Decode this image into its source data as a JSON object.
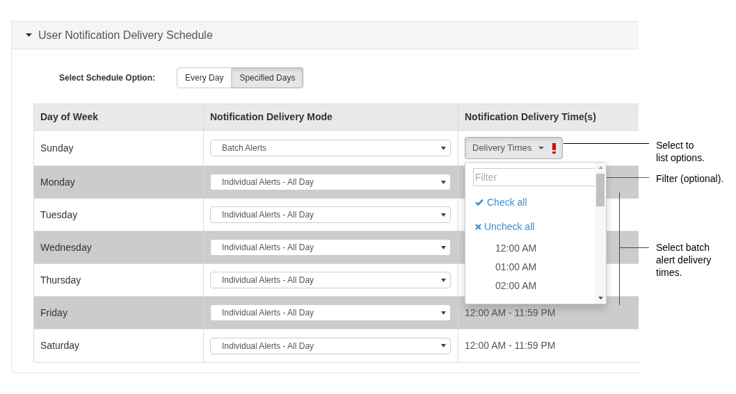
{
  "panel": {
    "title": "User Notification Delivery Schedule",
    "expanded": true
  },
  "schedule_option": {
    "label": "Select Schedule Option:",
    "options": [
      {
        "label": "Every Day",
        "selected": false
      },
      {
        "label": "Specified Days",
        "selected": true
      }
    ]
  },
  "table": {
    "columns": [
      "Day of Week",
      "Notification Delivery Mode",
      "Notification Delivery Time(s)"
    ],
    "rows": [
      {
        "day": "Sunday",
        "mode": "Batch Alerts",
        "time": {
          "kind": "picker",
          "label": "Delivery Times",
          "invalid": true,
          "open": true,
          "menu": {
            "filter_placeholder": "Filter",
            "actions": [
              {
                "kind": "check",
                "label": "Check all"
              },
              {
                "kind": "uncheck",
                "label": "Uncheck all"
              }
            ],
            "options": [
              "12:00 AM",
              "01:00 AM",
              "02:00 AM"
            ]
          }
        }
      },
      {
        "day": "Monday",
        "mode": "Individual Alerts - All Day"
      },
      {
        "day": "Tuesday",
        "mode": "Individual Alerts - All Day"
      },
      {
        "day": "Wednesday",
        "mode": "Individual Alerts - All Day"
      },
      {
        "day": "Thursday",
        "mode": "Individual Alerts - All Day"
      },
      {
        "day": "Friday",
        "mode": "Individual Alerts - All Day",
        "time": {
          "kind": "text",
          "text": "12:00 AM - 11:59 PM"
        }
      },
      {
        "day": "Saturday",
        "mode": "Individual Alerts - All Day",
        "time": {
          "kind": "text",
          "text": "12:00 AM - 11:59 PM"
        }
      }
    ]
  },
  "callouts": [
    {
      "kind": "line",
      "text": "Select to\nlist options."
    },
    {
      "kind": "line",
      "text": "Filter (optional)."
    },
    {
      "kind": "bracket",
      "text": "Select batch\nalert delivery\ntimes."
    }
  ]
}
